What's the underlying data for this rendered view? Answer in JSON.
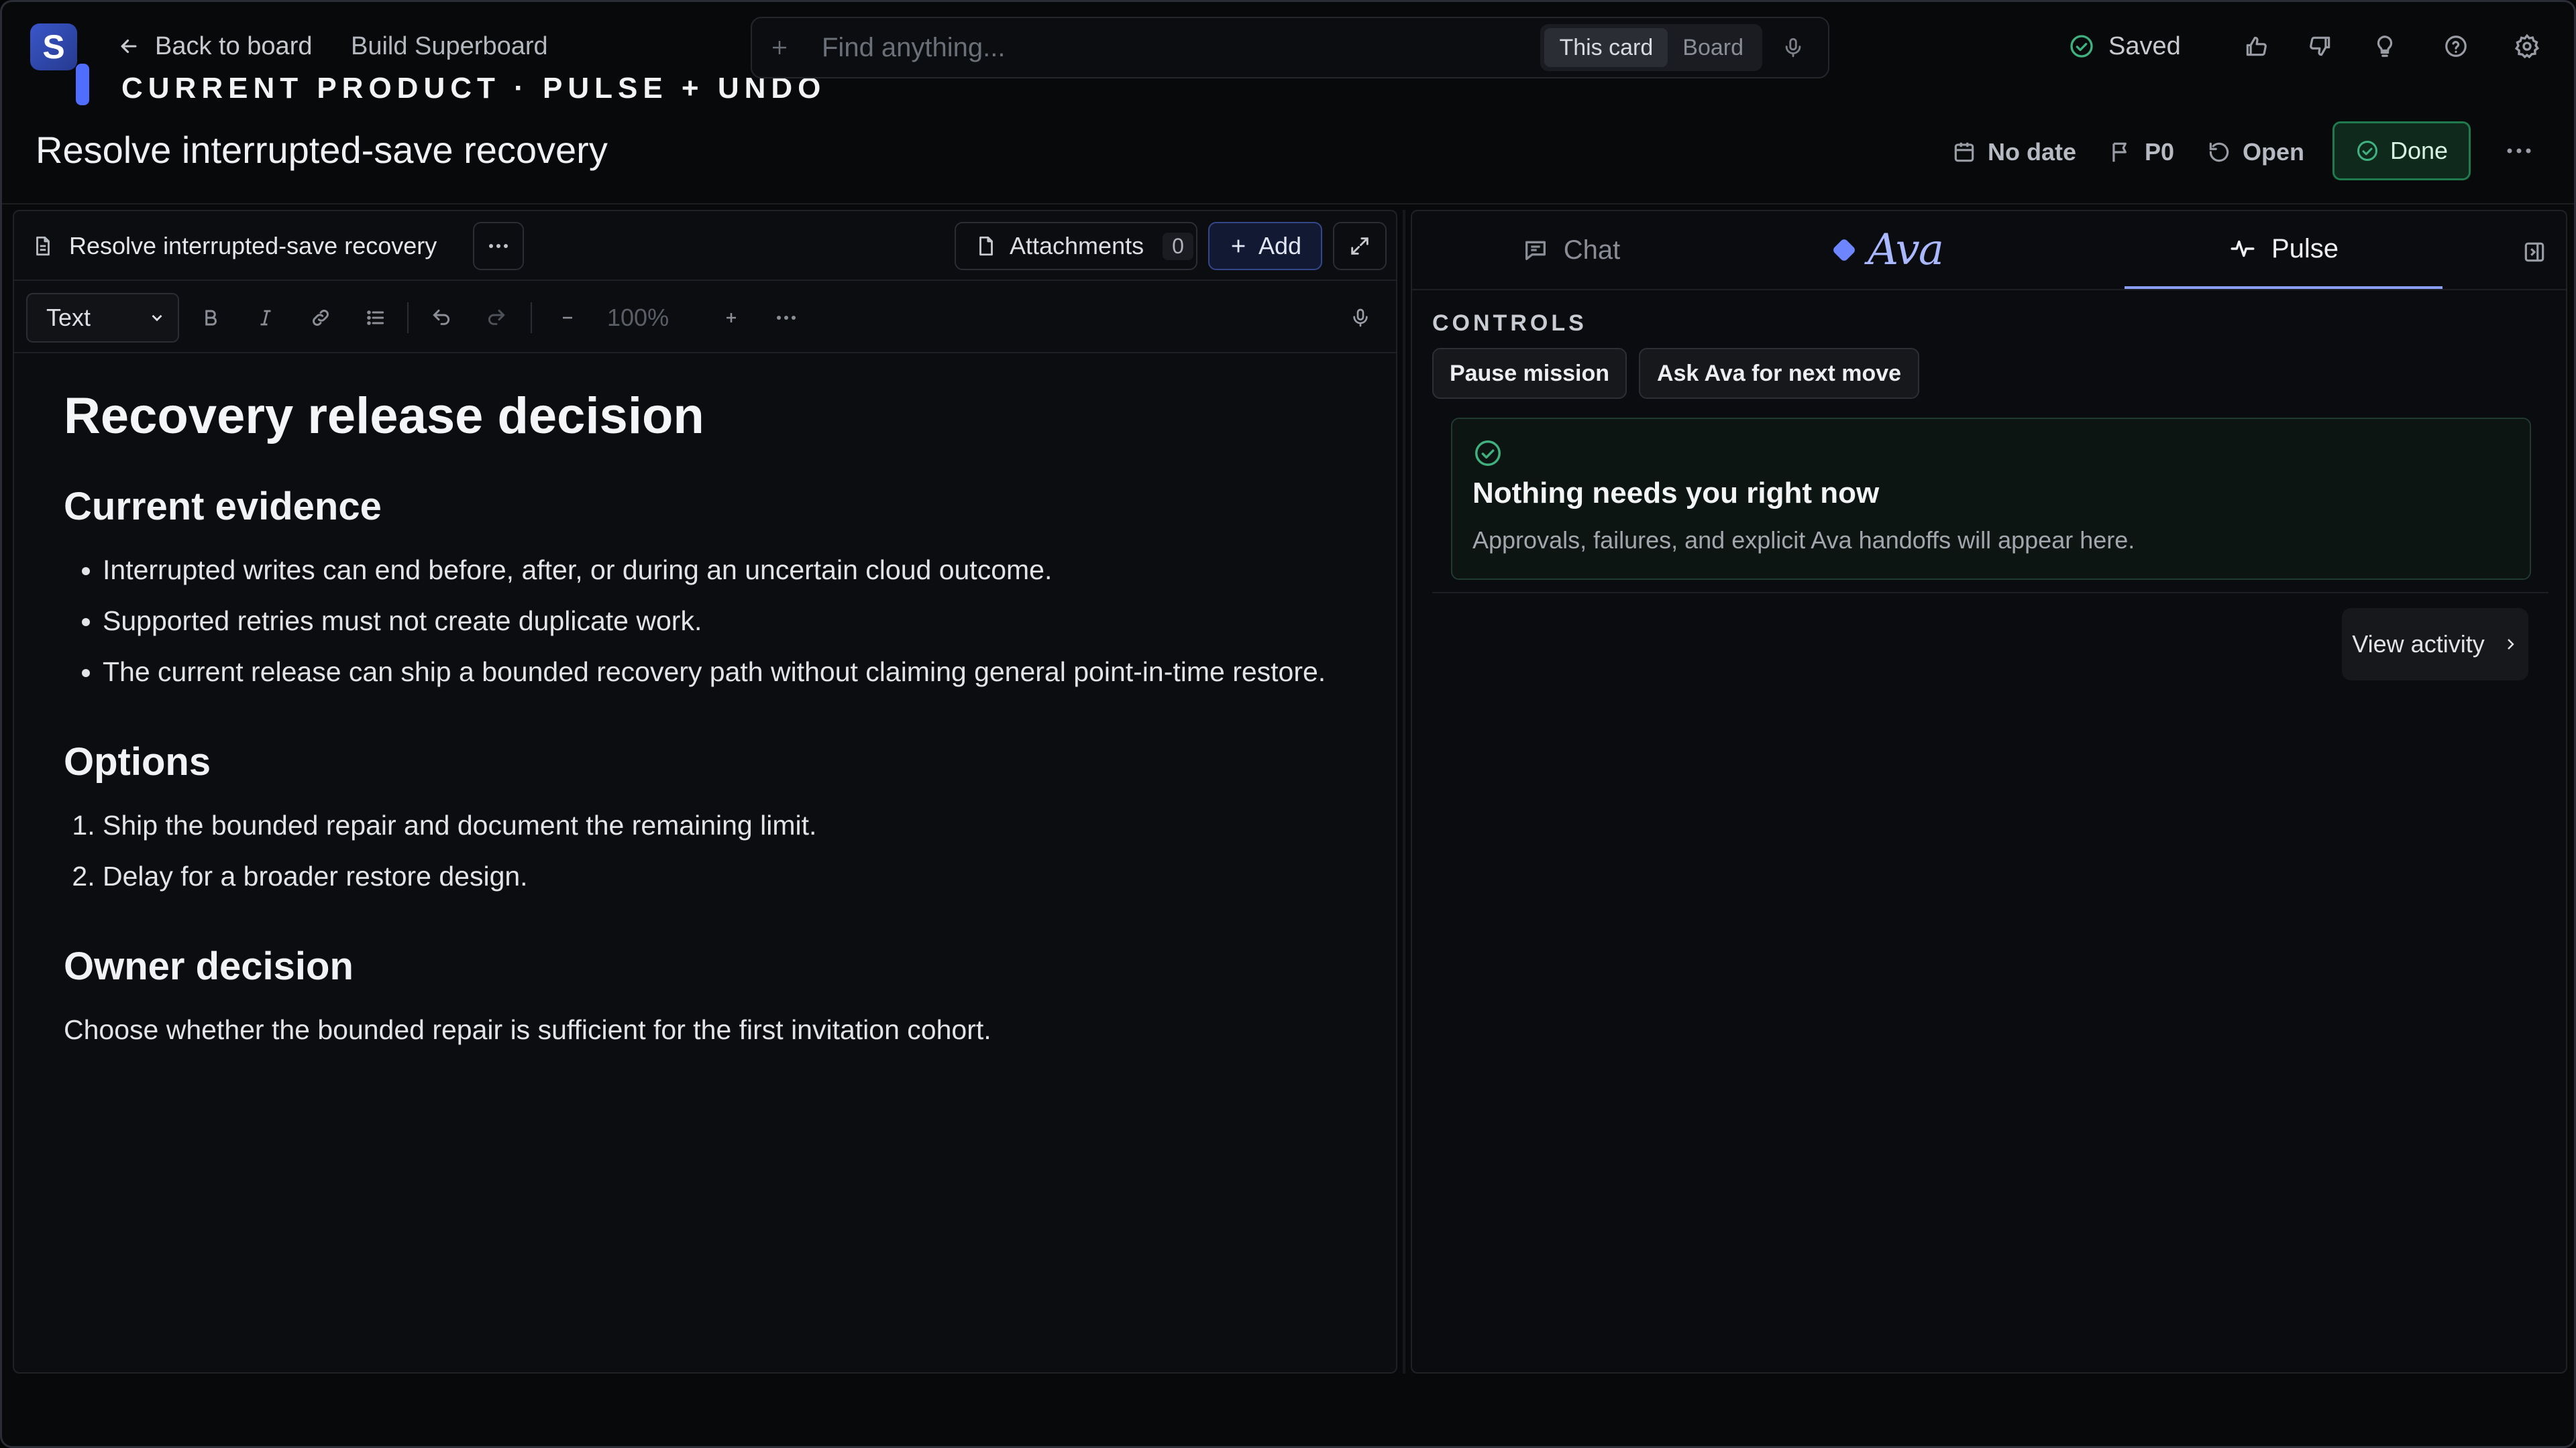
{
  "topbar": {
    "logo_letter": "S",
    "back_label": "Back to board",
    "breadcrumb": "Build Superboard",
    "banner": "CURRENT PRODUCT · PULSE + UNDO",
    "search_placeholder": "Find anything...",
    "scope_tabs": [
      "This card",
      "Board"
    ],
    "saved_label": "Saved",
    "icons": [
      "thumbs-up-icon",
      "thumbs-down-icon",
      "lightbulb-icon",
      "help-icon",
      "gear-icon"
    ]
  },
  "card": {
    "title": "Resolve interrupted-save recovery",
    "date_label": "No date",
    "priority_label": "P0",
    "status_label": "Open",
    "done_label": "Done"
  },
  "editor": {
    "doc_name": "Resolve interrupted-save recovery",
    "attachments_label": "Attachments",
    "attachments_count": "0",
    "add_label": "Add",
    "block_type": "Text",
    "zoom": "100%",
    "content": {
      "h1": "Recovery release decision",
      "sec1_title": "Current evidence",
      "sec1_items": [
        "Interrupted writes can end before, after, or during an uncertain cloud outcome.",
        "Supported retries must not create duplicate work.",
        "The current release can ship a bounded recovery path without claiming general point-in-time restore."
      ],
      "sec2_title": "Options",
      "sec2_items": [
        "Ship the bounded repair and document the remaining limit.",
        "Delay for a broader restore design."
      ],
      "sec3_title": "Owner decision",
      "sec3_text": "Choose whether the bounded repair is sufficient for the first invitation cohort."
    }
  },
  "side": {
    "tabs": [
      "Chat",
      "Ava",
      "Pulse"
    ],
    "active_tab": "Pulse",
    "controls_label": "CONTROLS",
    "pause_label": "Pause mission",
    "ask_label": "Ask Ava for next move",
    "notice_title": "Nothing needs you right now",
    "notice_body": "Approvals, failures, and explicit Ava handoffs will appear here.",
    "view_activity_label": "View activity"
  },
  "colors": {
    "accent": "#4f6dff",
    "done_green": "#1f7a4d",
    "background": "#08090b"
  }
}
